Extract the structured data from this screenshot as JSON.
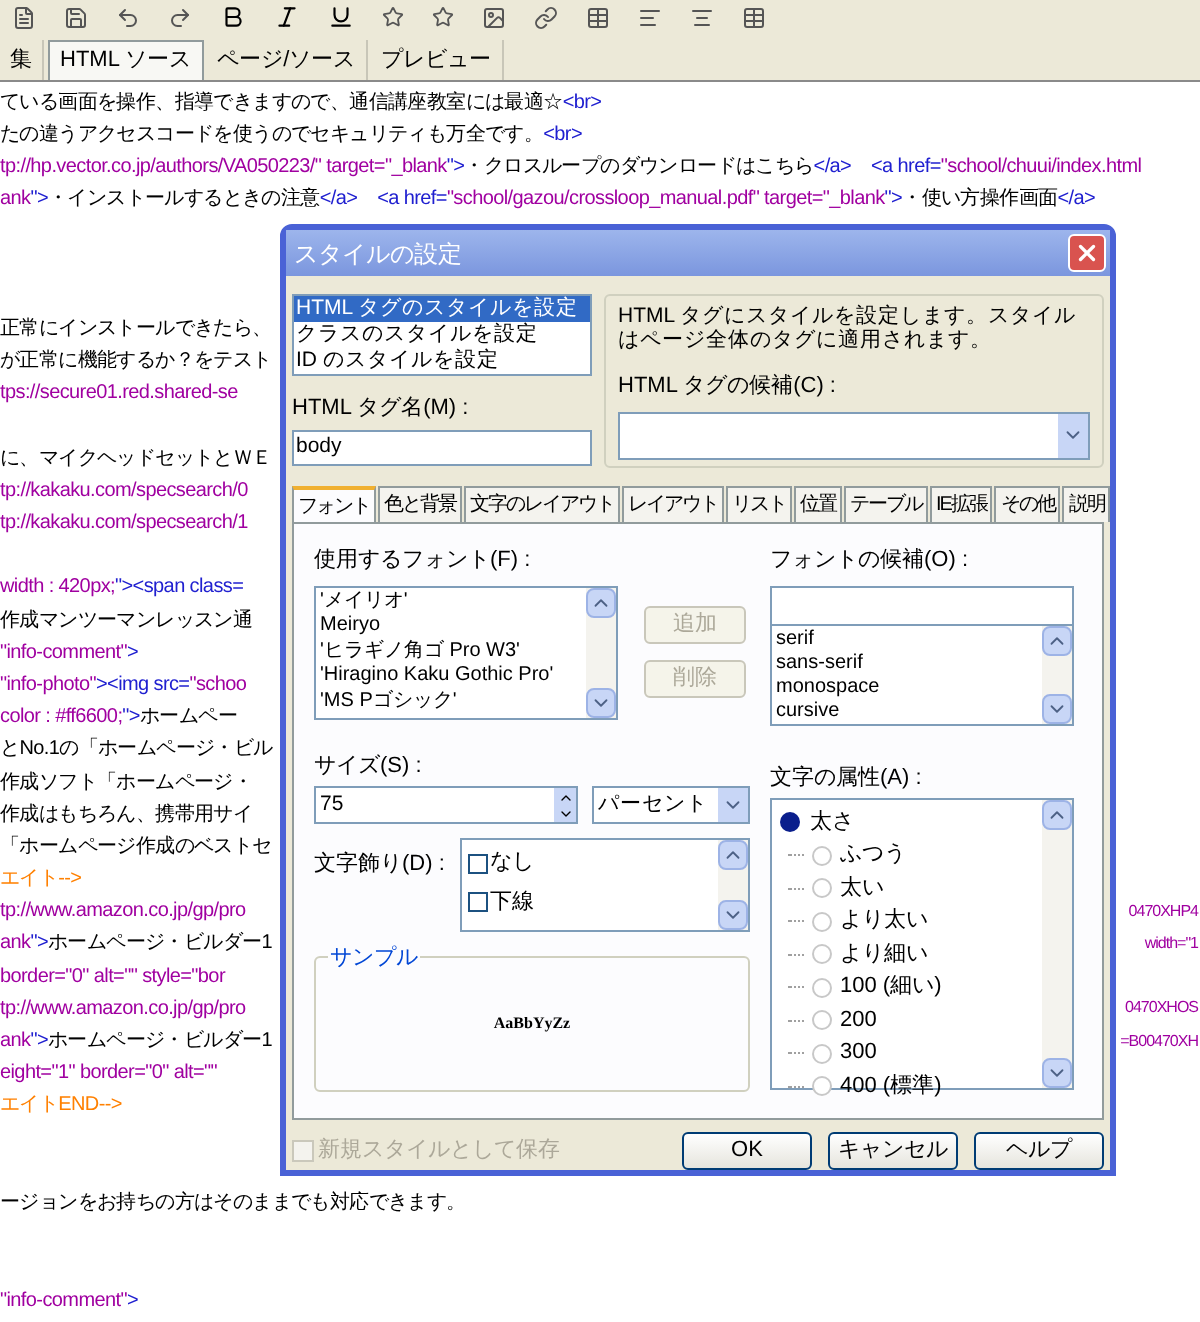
{
  "editor_tabs": [
    {
      "label": "集",
      "selected": false
    },
    {
      "label": "HTML ソース",
      "selected": true
    },
    {
      "label": "ページ/ソース",
      "selected": false
    },
    {
      "label": "プレビュー",
      "selected": false
    }
  ],
  "code_lines": [
    {
      "kind": "code",
      "segments": [
        {
          "kind": "text",
          "text": "ている画面を操作、指導できますので、通信講座教室には最適☆"
        },
        {
          "kind": "tag",
          "text": "<br>"
        }
      ]
    },
    {
      "kind": "code",
      "segments": [
        {
          "kind": "text",
          "text": "たの違うアクセスコードを使うのでセキュリティも万全です。"
        },
        {
          "kind": "tag",
          "text": "<br>"
        }
      ]
    },
    {
      "kind": "code",
      "segments": [
        {
          "kind": "attr",
          "text": "tp://hp.vector.co.jp/authors/VA050223/\" target=\"_blank"
        },
        {
          "kind": "tag",
          "text": "\">"
        },
        {
          "kind": "text",
          "text": "・クロスループのダウンロードはこちら"
        },
        {
          "kind": "tag",
          "text": "</a>    <a href="
        },
        {
          "kind": "attr",
          "text": "\"school/chuui/index.html"
        }
      ]
    },
    {
      "kind": "code",
      "segments": [
        {
          "kind": "attr",
          "text": "ank"
        },
        {
          "kind": "tag",
          "text": "\">"
        },
        {
          "kind": "text",
          "text": "・インストールするときの注意"
        },
        {
          "kind": "tag",
          "text": "</a>    <a href="
        },
        {
          "kind": "attr",
          "text": "\"school/gazou/crossloop_manual.pdf\" target=\"_blank"
        },
        {
          "kind": "tag",
          "text": "\">"
        },
        {
          "kind": "text",
          "text": "・使い方操作画面"
        },
        {
          "kind": "tag",
          "text": "</a>"
        }
      ]
    },
    {
      "kind": "blank"
    },
    {
      "kind": "blank"
    },
    {
      "kind": "blank"
    },
    {
      "kind": "code",
      "segments": [
        {
          "kind": "text",
          "text": "正常にインストールできたら、"
        }
      ]
    },
    {
      "kind": "code",
      "segments": [
        {
          "kind": "text",
          "text": "が正常に機能するか？をテスト"
        }
      ]
    },
    {
      "kind": "code",
      "segments": [
        {
          "kind": "attr",
          "text": "tps://secure01.red.shared-se"
        }
      ]
    },
    {
      "kind": "blank"
    },
    {
      "kind": "code",
      "segments": [
        {
          "kind": "text",
          "text": "に、マイクヘッドセットとＷＥ"
        }
      ]
    },
    {
      "kind": "code",
      "segments": [
        {
          "kind": "attr",
          "text": "tp://kakaku.com/specsearch/0"
        }
      ]
    },
    {
      "kind": "code",
      "segments": [
        {
          "kind": "attr",
          "text": "tp://kakaku.com/specsearch/1"
        }
      ]
    },
    {
      "kind": "blank"
    },
    {
      "kind": "code",
      "segments": [
        {
          "kind": "attr",
          "text": "width : 420px;"
        },
        {
          "kind": "tag",
          "text": "\"><span class="
        }
      ]
    },
    {
      "kind": "code",
      "segments": [
        {
          "kind": "text",
          "text": "作成マンツーマンレッスン通"
        }
      ]
    },
    {
      "kind": "code",
      "segments": [
        {
          "kind": "attr",
          "text": "\"info-comment\""
        },
        {
          "kind": "tag",
          "text": ">"
        }
      ]
    },
    {
      "kind": "code",
      "segments": [
        {
          "kind": "attr",
          "text": "\"info-photo\""
        },
        {
          "kind": "tag",
          "text": "><img src="
        },
        {
          "kind": "attr",
          "text": "\"schoo"
        }
      ]
    },
    {
      "kind": "code",
      "segments": [
        {
          "kind": "attr",
          "text": "color : #ff6600;"
        },
        {
          "kind": "tag",
          "text": "\">"
        },
        {
          "kind": "text",
          "text": "ホームペー"
        }
      ]
    },
    {
      "kind": "code",
      "segments": [
        {
          "kind": "text",
          "text": "とNo.1の「ホームページ・ビル"
        }
      ]
    },
    {
      "kind": "code",
      "segments": [
        {
          "kind": "text",
          "text": "作成ソフト「ホームページ・"
        }
      ]
    },
    {
      "kind": "code",
      "segments": [
        {
          "kind": "text",
          "text": "作成はもちろん、携帯用サイ"
        }
      ]
    },
    {
      "kind": "code",
      "segments": [
        {
          "kind": "text",
          "text": "「ホームページ作成のベストセ"
        }
      ]
    },
    {
      "kind": "code",
      "segments": [
        {
          "kind": "comment",
          "text": "エイト-->"
        }
      ]
    },
    {
      "kind": "code",
      "segments": [
        {
          "kind": "attr",
          "text": "tp://www.amazon.co.jp/gp/pro"
        }
      ],
      "right": "0470XHP4"
    },
    {
      "kind": "code",
      "segments": [
        {
          "kind": "attr",
          "text": "ank"
        },
        {
          "kind": "tag",
          "text": "\">"
        },
        {
          "kind": "text",
          "text": "ホームページ・ビルダー1"
        }
      ],
      "right": "width=\"1"
    },
    {
      "kind": "code",
      "segments": [
        {
          "kind": "attr",
          "text": "border=\"0\" alt=\"\" style=\"bor"
        }
      ]
    },
    {
      "kind": "code",
      "segments": [
        {
          "kind": "attr",
          "text": "tp://www.amazon.co.jp/gp/pro"
        }
      ],
      "right": "0470XHOS"
    },
    {
      "kind": "code",
      "segments": [
        {
          "kind": "attr",
          "text": "ank"
        },
        {
          "kind": "tag",
          "text": "\">"
        },
        {
          "kind": "text",
          "text": "ホームページ・ビルダー1"
        }
      ],
      "right": "=B00470XH"
    },
    {
      "kind": "code",
      "segments": [
        {
          "kind": "attr",
          "text": "eight=\"1\" border=\"0\" alt=\"\""
        }
      ]
    },
    {
      "kind": "code",
      "segments": [
        {
          "kind": "comment",
          "text": "エイトEND-->"
        }
      ]
    },
    {
      "kind": "blank"
    },
    {
      "kind": "blank"
    },
    {
      "kind": "code",
      "segments": [
        {
          "kind": "text",
          "text": "ージョンをお持ちの方はそのままでも対応できます。"
        }
      ]
    },
    {
      "kind": "blank"
    },
    {
      "kind": "blank"
    },
    {
      "kind": "code",
      "segments": [
        {
          "kind": "attr",
          "text": "\"info-comment\""
        },
        {
          "kind": "tag",
          "text": ">"
        }
      ]
    }
  ],
  "dialog": {
    "title": "スタイルの設定",
    "mode_list": [
      {
        "label": "HTML タグのスタイルを設定",
        "selected": true
      },
      {
        "label": "クラスのスタイルを設定",
        "selected": false
      },
      {
        "label": "ID のスタイルを設定",
        "selected": false
      }
    ],
    "tag_name_label": "HTML タグ名(M) :",
    "tag_name_value": "body",
    "description": "HTML タグにスタイルを設定します。スタイルはページ全体のタグに適用されます。",
    "candidates_label": "HTML タグの候補(C) :",
    "tabs": [
      {
        "label": "フォント",
        "selected": true
      },
      {
        "label": "色と背景",
        "selected": false
      },
      {
        "label": "文字のレイアウト",
        "selected": false
      },
      {
        "label": "レイアウト",
        "selected": false
      },
      {
        "label": "リスト",
        "selected": false
      },
      {
        "label": "位置",
        "selected": false
      },
      {
        "label": "テーブル",
        "selected": false
      },
      {
        "label": "IE拡張",
        "selected": false
      },
      {
        "label": "その他",
        "selected": false
      },
      {
        "label": "説明",
        "selected": false
      }
    ],
    "font_label": "使用するフォント(F) :",
    "fonts": [
      "'メイリオ'",
      "Meiryo",
      "'ヒラギノ角ゴ Pro W3'",
      "'Hiragino Kaku Gothic Pro'",
      "'MS Pゴシック'"
    ],
    "add_button": {
      "label": "追加",
      "disabled": true
    },
    "delete_button": {
      "label": "削除",
      "disabled": true
    },
    "font_candidates_label": "フォントの候補(O) :",
    "font_candidates": [
      "serif",
      "sans-serif",
      "monospace",
      "cursive"
    ],
    "size_label": "サイズ(S) :",
    "size_value": "75",
    "unit_value": "パーセント",
    "attributes_label": "文字の属性(A) :",
    "attribute_tree": {
      "label": "太さ",
      "selected": true,
      "children": [
        {
          "label": "ふつう",
          "selected": false
        },
        {
          "label": "太い",
          "selected": false
        },
        {
          "label": "より太い",
          "selected": false
        },
        {
          "label": "より細い",
          "selected": false
        },
        {
          "label": "100 (細い)",
          "selected": false
        },
        {
          "label": "200",
          "selected": false
        },
        {
          "label": "300",
          "selected": false
        },
        {
          "label": "400 (標準)",
          "selected": false
        }
      ]
    },
    "decoration_label": "文字飾り(D) :",
    "decorations": [
      {
        "label": "なし",
        "checked": false
      },
      {
        "label": "下線",
        "checked": false
      }
    ],
    "sample_label": "サンプル",
    "sample_text": "AaBbYyZz",
    "save_new": {
      "label": "新規スタイルとして保存",
      "checked": false,
      "disabled": true
    },
    "buttons": [
      "OK",
      "キャンセル",
      "ヘルプ"
    ]
  }
}
